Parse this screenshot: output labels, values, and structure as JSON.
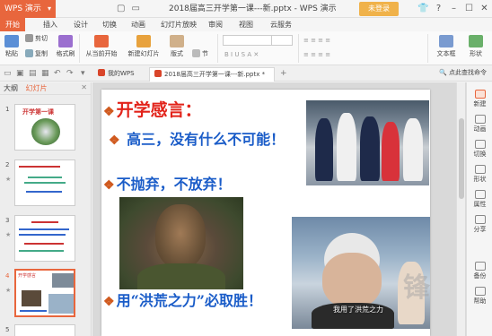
{
  "app": {
    "name": "WPS 演示",
    "window_title": "2018届高三开学第一课---新.pptx - WPS 演示",
    "login_label": "未登录"
  },
  "menu": {
    "tabs": [
      "开始",
      "插入",
      "设计",
      "切换",
      "动画",
      "幻灯片放映",
      "审阅",
      "视图",
      "云服务"
    ]
  },
  "ribbon": {
    "paste": "粘贴",
    "cut": "剪切",
    "copy": "复制",
    "format_painter": "格式刷",
    "from_current": "从当前开始",
    "new_slide": "新建幻灯片",
    "layout": "版式",
    "section": "节",
    "textbox": "文本框",
    "shape": "形状"
  },
  "doc_tabs": {
    "first": "我的WPS",
    "active": "2018届高三开学第一课---新.pptx *",
    "add": "+",
    "smart_button": "点此查找命令"
  },
  "left_panel": {
    "outline_tab": "大纲",
    "slides_tab": "幻灯片",
    "thumbs": [
      {
        "num": "1",
        "title": "开学第一课"
      },
      {
        "num": "2",
        "title": "开学第一课"
      },
      {
        "num": "3",
        "title": "开学第一课"
      },
      {
        "num": "4",
        "title": "开学感言"
      },
      {
        "num": "5",
        "title": ""
      }
    ]
  },
  "slide": {
    "line1": "开学感言：",
    "line2": "高三，没有什么不可能！",
    "line3": "不抛弃，不放弃！",
    "line4": "用“洪荒之力”必取胜！",
    "bullet": "❖",
    "caption": "我用了洪荒之力",
    "watermark": "锋"
  },
  "right_pane": {
    "items": [
      "新建",
      "动画",
      "切换",
      "形状",
      "属性",
      "分享",
      "备份",
      "帮助"
    ]
  },
  "colors": {
    "accent": "#e8663d",
    "title_red": "#e2231a",
    "text_blue": "#1a5cc8"
  }
}
